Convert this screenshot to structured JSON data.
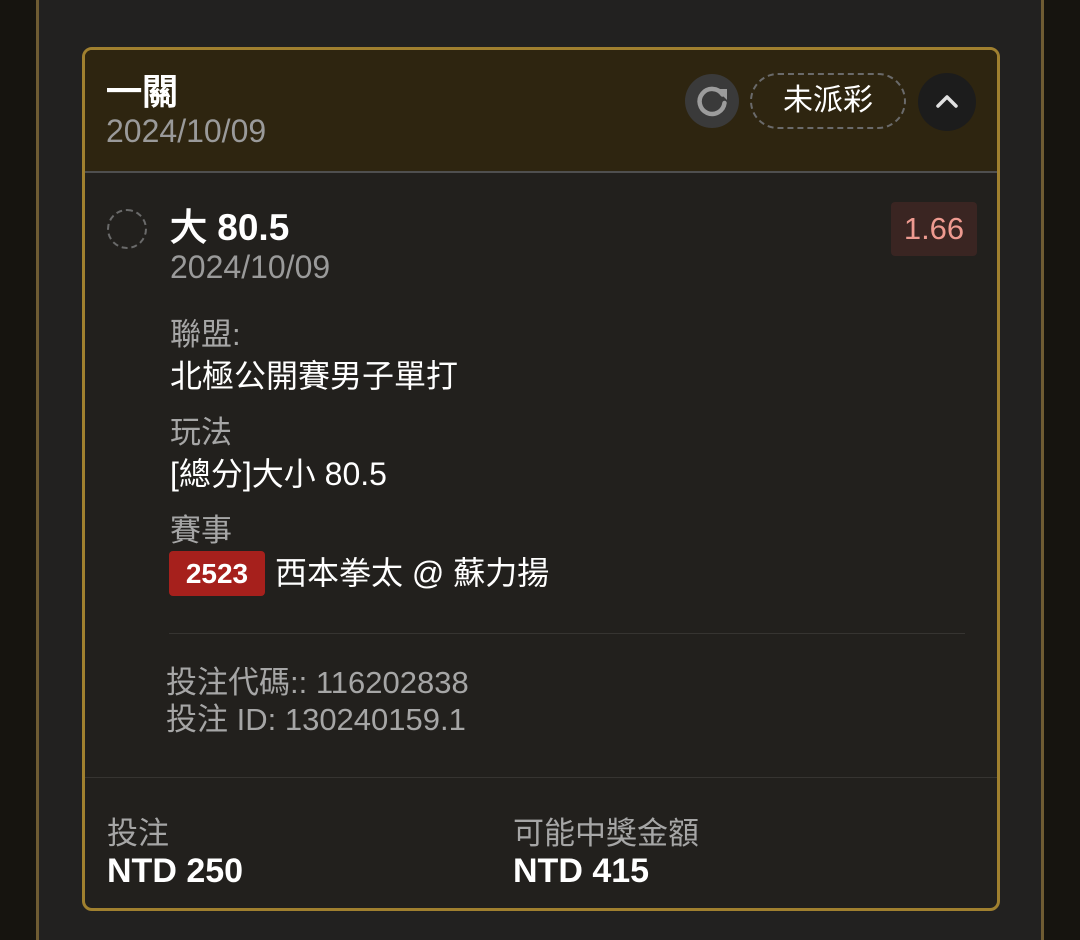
{
  "header": {
    "title": "一關",
    "date": "2024/10/09",
    "status_label": "未派彩",
    "refresh_icon": "refresh-icon",
    "collapse_icon": "chevron-up-icon"
  },
  "selection": {
    "title": "大 80.5",
    "date": "2024/10/09",
    "odds": "1.66",
    "odds_color": "#ee9a90",
    "league_label": "聯盟:",
    "league_value": "北極公開賽男子單打",
    "market_label": "玩法",
    "market_value": "[總分]大小 80.5",
    "event_label": "賽事",
    "event_id": "2523",
    "event_id_color": "#a6201c",
    "event_name": "西本拳太 @ 蘇力揚"
  },
  "codes": {
    "bet_code": "投注代碼:: 116202838",
    "bet_id": "投注 ID: 130240159.1"
  },
  "footer": {
    "stake_label": "投注",
    "stake_value": "NTD 250",
    "payout_label": "可能中獎金額",
    "payout_value": "NTD 415"
  },
  "colors": {
    "accent_border": "#a0802f",
    "header_bg": "#2e2510",
    "card_bg": "#22201d"
  }
}
